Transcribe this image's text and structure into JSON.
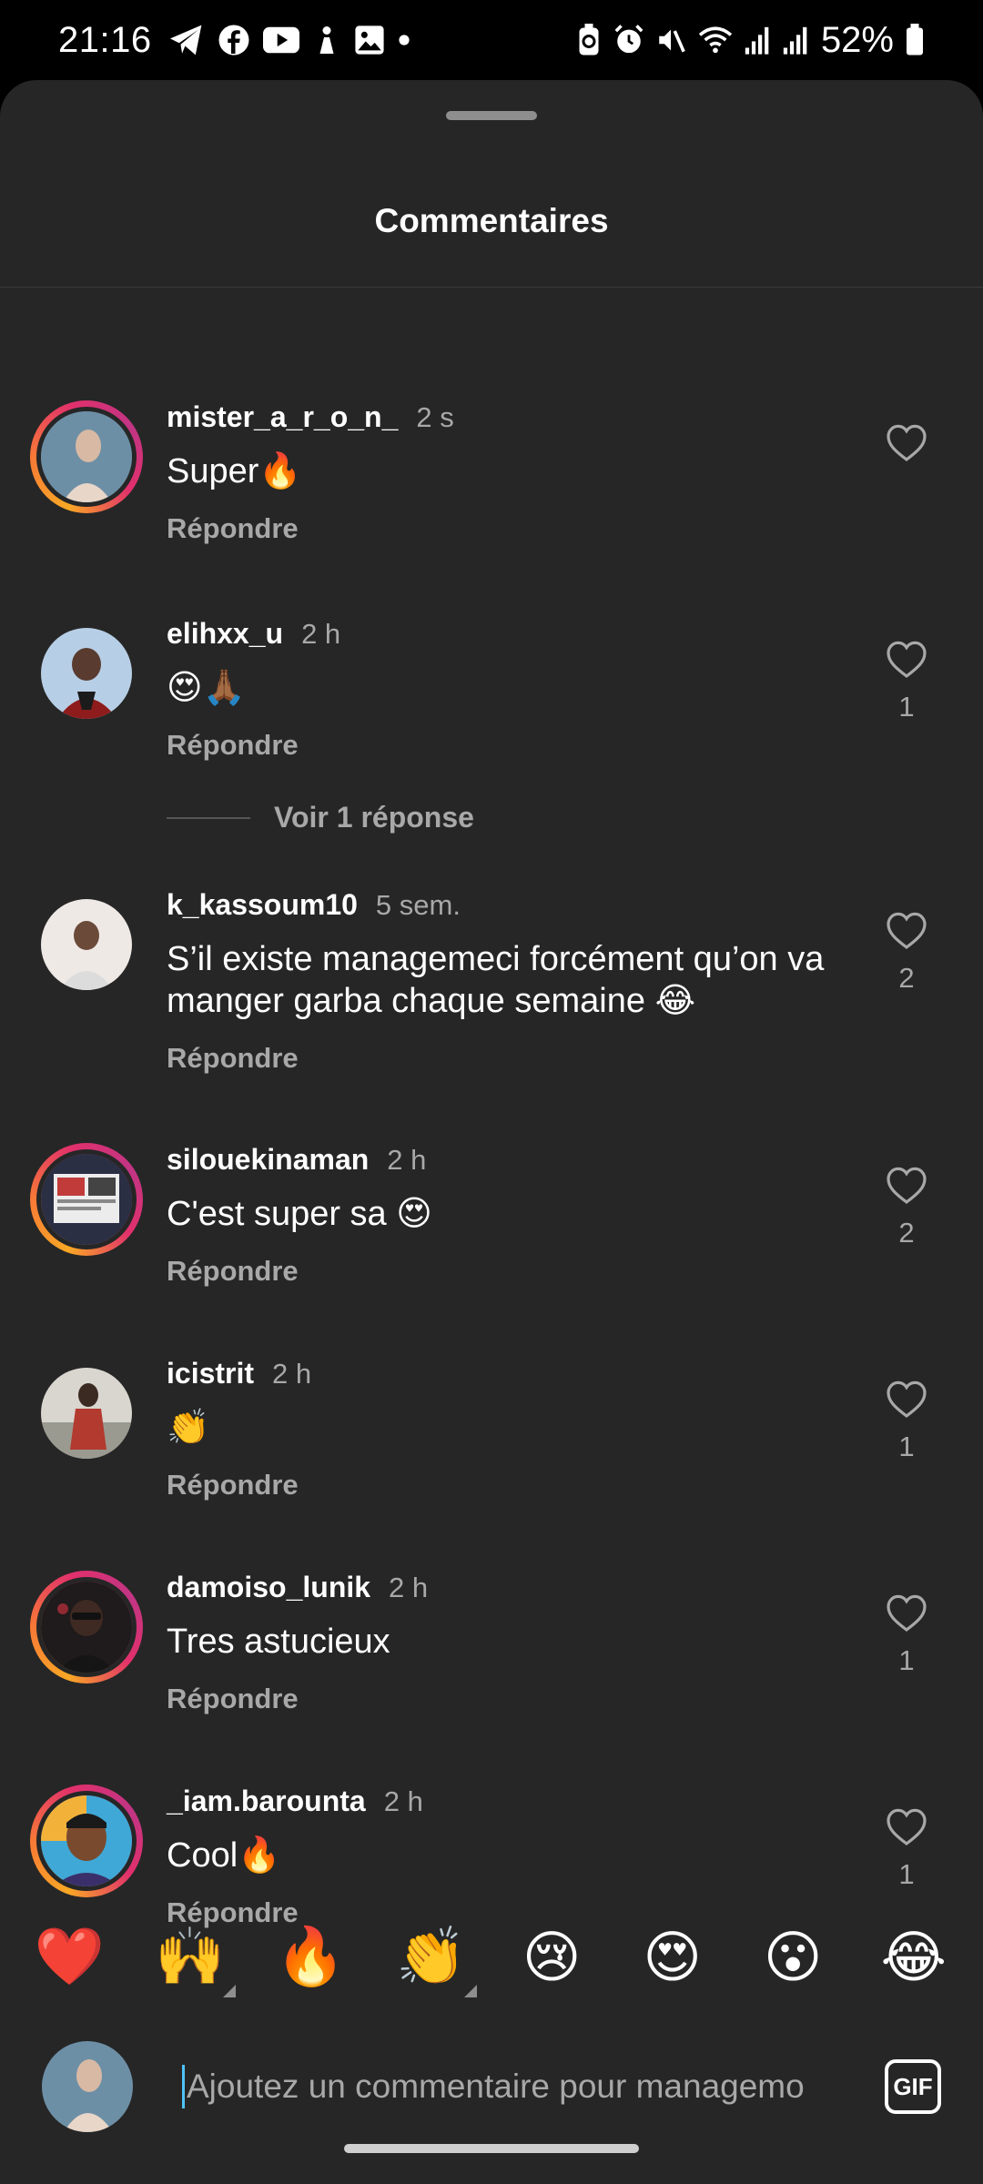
{
  "status_bar": {
    "time": "21:16",
    "left_icons": [
      "telegram-icon",
      "facebook-icon",
      "youtube-icon",
      "pinterest-icon",
      "gallery-icon",
      "dot-icon"
    ],
    "right_icons": [
      "battery-saver-icon",
      "alarm-icon",
      "mute-icon",
      "wifi-icon",
      "signal-icon",
      "signal-icon"
    ],
    "battery": "52%"
  },
  "sheet": {
    "title": "Commentaires"
  },
  "comments": [
    {
      "username": "mister_a_r_o_n_",
      "time": "2 s",
      "text": "Super🔥",
      "reply": "Répondre",
      "likes": "",
      "ring": true,
      "avatar_color": "#5b7f95"
    },
    {
      "username": "elihxx_u",
      "time": "2 h",
      "text": "😍🙏🏾",
      "reply": "Répondre",
      "likes": "1",
      "ring": false,
      "avatar_color": "#a9c7e4"
    },
    {
      "username": "k_kassoum10",
      "time": "5 sem.",
      "text": "S’il existe managemeci forcément qu’on va manger garba chaque semaine 😂",
      "reply": "Répondre",
      "likes": "2",
      "ring": false,
      "avatar_color": "#e9e4e1"
    },
    {
      "username": "silouekinaman",
      "time": "2 h",
      "text": "C'est super sa 😍",
      "reply": "Répondre",
      "likes": "2",
      "ring": true,
      "avatar_color": "#3b3f55"
    },
    {
      "username": "icistrit",
      "time": "2 h",
      "text": "👏",
      "reply": "Répondre",
      "likes": "1",
      "ring": false,
      "avatar_color": "#b8433a"
    },
    {
      "username": "damoiso_lunik",
      "time": "2 h",
      "text": "Tres astucieux",
      "reply": "Répondre",
      "likes": "1",
      "ring": true,
      "avatar_color": "#3a2a2a"
    },
    {
      "username": "_iam.barounta",
      "time": "2 h",
      "text": "Cool🔥",
      "reply": "Répondre",
      "likes": "1",
      "ring": true,
      "avatar_color": "#f0a04b"
    }
  ],
  "view_replies": "Voir 1 réponse",
  "emoji_bar": [
    "❤️",
    "🙌",
    "🔥",
    "👏",
    "😢",
    "😍",
    "😮",
    "😂"
  ],
  "input": {
    "placeholder": "Ajoutez un commentaire pour managemo",
    "gif_label": "GIF"
  }
}
